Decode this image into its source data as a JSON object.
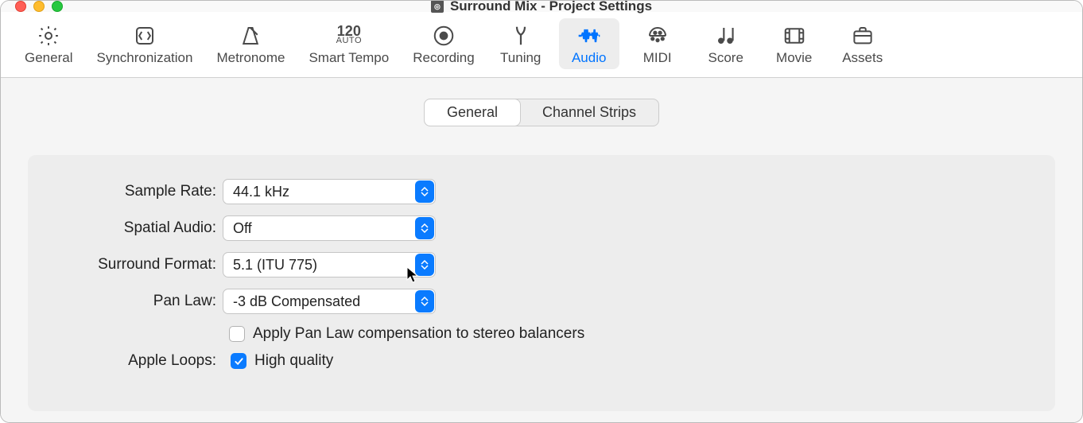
{
  "window": {
    "title": "Surround Mix - Project Settings"
  },
  "toolbar": {
    "items": [
      {
        "label": "General"
      },
      {
        "label": "Synchronization"
      },
      {
        "label": "Metronome"
      },
      {
        "label": "Smart Tempo",
        "tempo": "120",
        "tempo_sub": "AUTO"
      },
      {
        "label": "Recording"
      },
      {
        "label": "Tuning"
      },
      {
        "label": "Audio"
      },
      {
        "label": "MIDI"
      },
      {
        "label": "Score"
      },
      {
        "label": "Movie"
      },
      {
        "label": "Assets"
      }
    ],
    "active": "Audio"
  },
  "tabs": {
    "general": "General",
    "channel_strips": "Channel Strips",
    "active": "General"
  },
  "form": {
    "sample_rate": {
      "label": "Sample Rate:",
      "value": "44.1 kHz"
    },
    "spatial_audio": {
      "label": "Spatial Audio:",
      "value": "Off"
    },
    "surround_format": {
      "label": "Surround Format:",
      "value": "5.1 (ITU 775)"
    },
    "pan_law": {
      "label": "Pan Law:",
      "value": "-3 dB Compensated"
    },
    "pan_law_checkbox": {
      "label": "Apply Pan Law compensation to stereo balancers",
      "checked": false
    },
    "apple_loops": {
      "label": "Apple Loops:",
      "checkbox_label": "High quality",
      "checked": true
    }
  }
}
